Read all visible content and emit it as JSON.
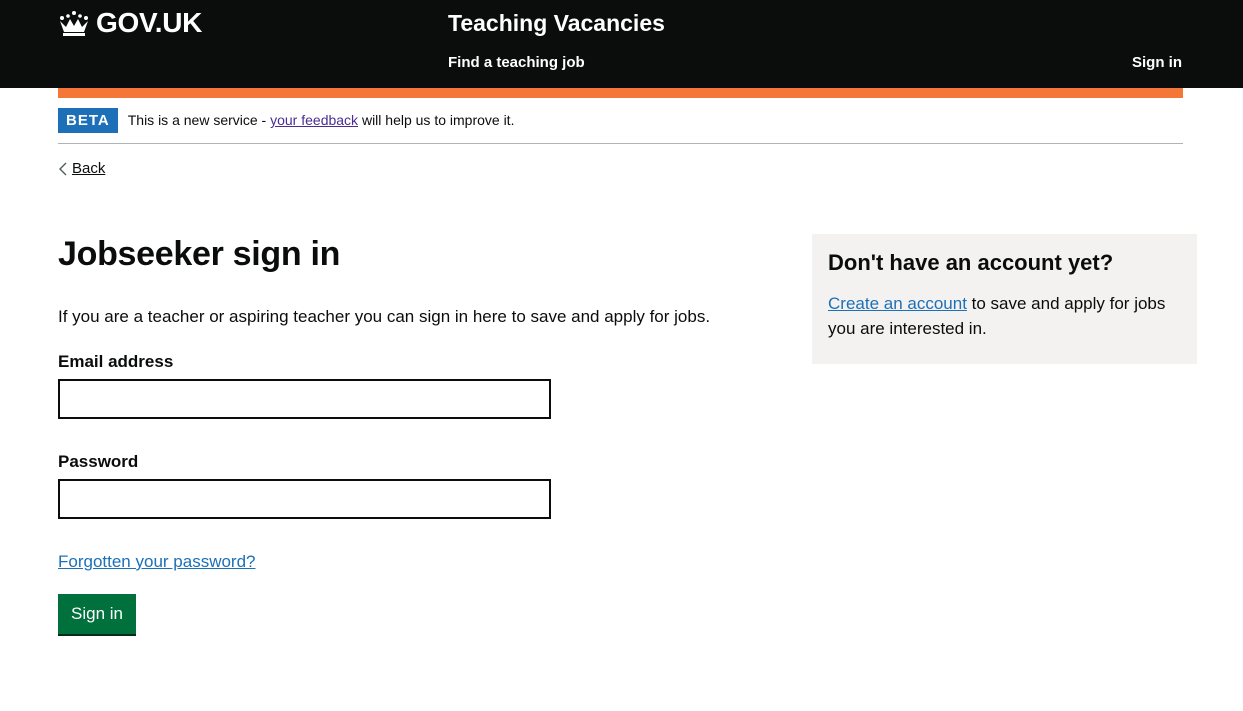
{
  "header": {
    "logo_text": "GOV.UK",
    "service_name": "Teaching Vacancies",
    "nav": {
      "find_job": "Find a teaching job",
      "sign_in": "Sign in"
    }
  },
  "phase_banner": {
    "tag": "BETA",
    "text_before": "This is a new service - ",
    "link": "your feedback",
    "text_after": " will help us to improve it."
  },
  "back_link": "Back",
  "main": {
    "title": "Jobseeker sign in",
    "intro": "If you are a teacher or aspiring teacher you can sign in here to save and apply for jobs.",
    "email": {
      "label": "Email address",
      "value": ""
    },
    "password": {
      "label": "Password",
      "value": ""
    },
    "forgot_link": "Forgotten your password?",
    "submit_label": "Sign in"
  },
  "aside": {
    "title": "Don't have an account yet?",
    "link": "Create an account",
    "text_after": " to save and apply for jobs you are interested in."
  },
  "colors": {
    "header_bg": "#0b0c0c",
    "phase_bar": "#f47738",
    "beta_tag": "#1d70b8",
    "link": "#1d70b8",
    "visited_link": "#4c2c92",
    "button": "#00703c",
    "aside_bg": "#f3f2f1"
  },
  "icons": {
    "logo": "crown-icon",
    "back": "chevron-left-icon"
  }
}
